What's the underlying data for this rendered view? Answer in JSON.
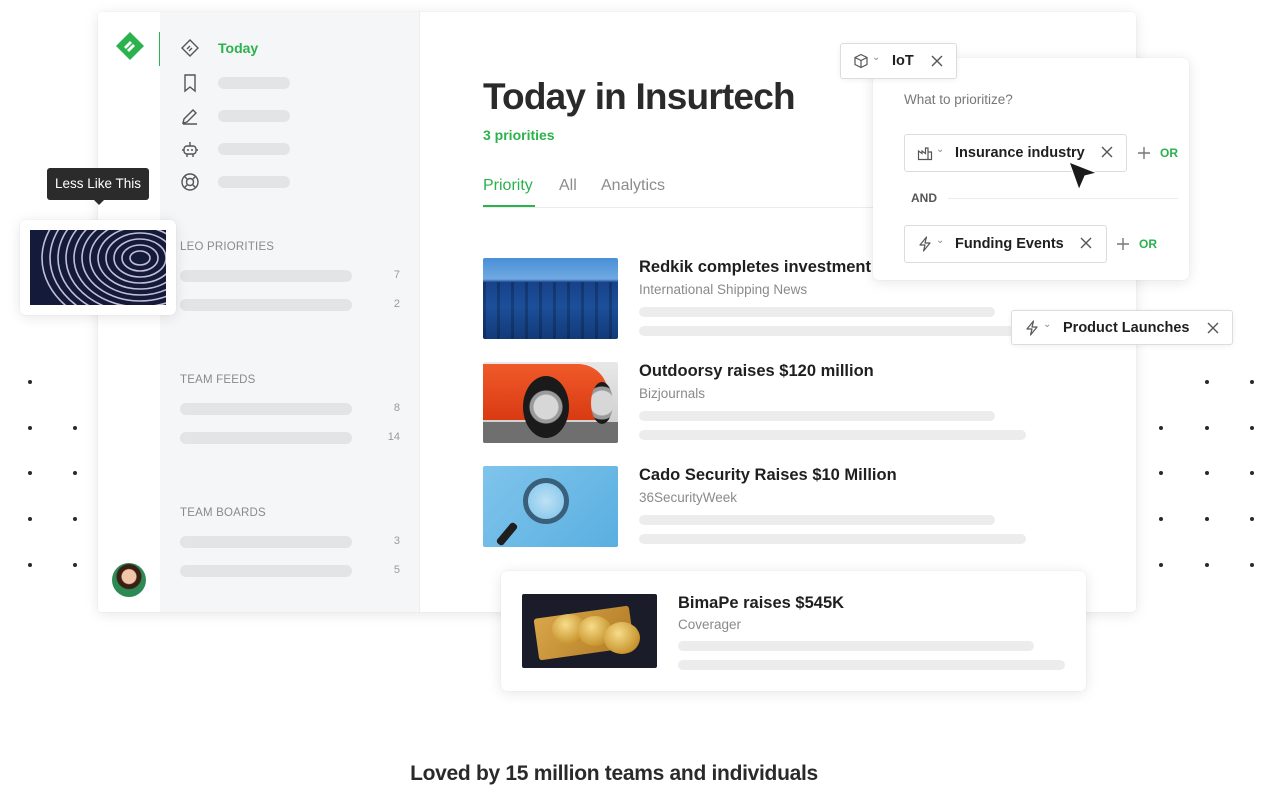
{
  "sidebar": {
    "today_label": "Today",
    "sections": [
      {
        "title": "LEO PRIORITIES",
        "counts": [
          "7",
          "2"
        ]
      },
      {
        "title": "TEAM FEEDS",
        "counts": [
          "8",
          "14"
        ]
      },
      {
        "title": "TEAM BOARDS",
        "counts": [
          "3",
          "5"
        ]
      }
    ]
  },
  "main": {
    "title": "Today in Insurtech",
    "priorities_count": "3 priorities",
    "tabs": [
      "Priority",
      "All",
      "Analytics"
    ],
    "articles": [
      {
        "title": "Redkik completes investment",
        "source": "International Shipping News"
      },
      {
        "title": "Outdoorsy raises $120 million",
        "source": "Bizjournals"
      },
      {
        "title": "Cado Security Raises $10 Million",
        "source": "36SecurityWeek"
      }
    ]
  },
  "tooltip": {
    "text": "Less Like This"
  },
  "prioritize": {
    "question": "What to prioritize?",
    "chip_1": "Insurance industry",
    "and_label": "AND",
    "chip_2": "Funding Events",
    "or_label": "OR"
  },
  "floating_chips": {
    "iot": "IoT",
    "product_launches": "Product Launches"
  },
  "featured": {
    "title": "BimaPe raises $545K",
    "source": "Coverager"
  },
  "footer": {
    "tagline": "Loved by 15 million teams and individuals"
  },
  "colors": {
    "accent": "#2bb24c",
    "text": "#1f1f1f",
    "muted": "#8a8a8a"
  },
  "icons": [
    "feedly-logo-icon",
    "today-icon",
    "bookmark-icon",
    "pencil-icon",
    "robot-icon",
    "lifebuoy-icon",
    "box-icon",
    "factory-icon",
    "lightning-icon",
    "close-icon",
    "plus-icon",
    "cursor-icon",
    "chevron-down-icon"
  ]
}
